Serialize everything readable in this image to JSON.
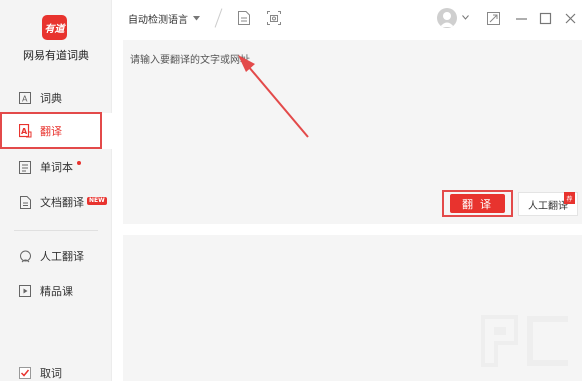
{
  "app": {
    "logo_text": "有道",
    "name": "网易有道词典"
  },
  "sidebar": {
    "items": [
      {
        "label": "词典",
        "icon": "dictionary-icon"
      },
      {
        "label": "翻译",
        "icon": "translate-icon"
      },
      {
        "label": "单词本",
        "icon": "wordbook-icon"
      },
      {
        "label": "文档翻译",
        "icon": "document-icon",
        "badge": "NEW"
      },
      {
        "label": "人工翻译",
        "icon": "human-translation-icon"
      },
      {
        "label": "精品课",
        "icon": "course-icon"
      },
      {
        "label": "取词",
        "icon": "checkbox-icon"
      }
    ]
  },
  "toolbar": {
    "language": "自动检测语言"
  },
  "input": {
    "placeholder": "请输入要翻译的文字或网址"
  },
  "actions": {
    "translate": "翻 译",
    "human_translate": "人工翻译",
    "human_tag": "荐"
  },
  "colors": {
    "accent": "#e8332e",
    "panel_bg": "#f5f5f5",
    "sidebar_bg": "#f4f4f4",
    "highlight_box": "#e34a4a"
  }
}
